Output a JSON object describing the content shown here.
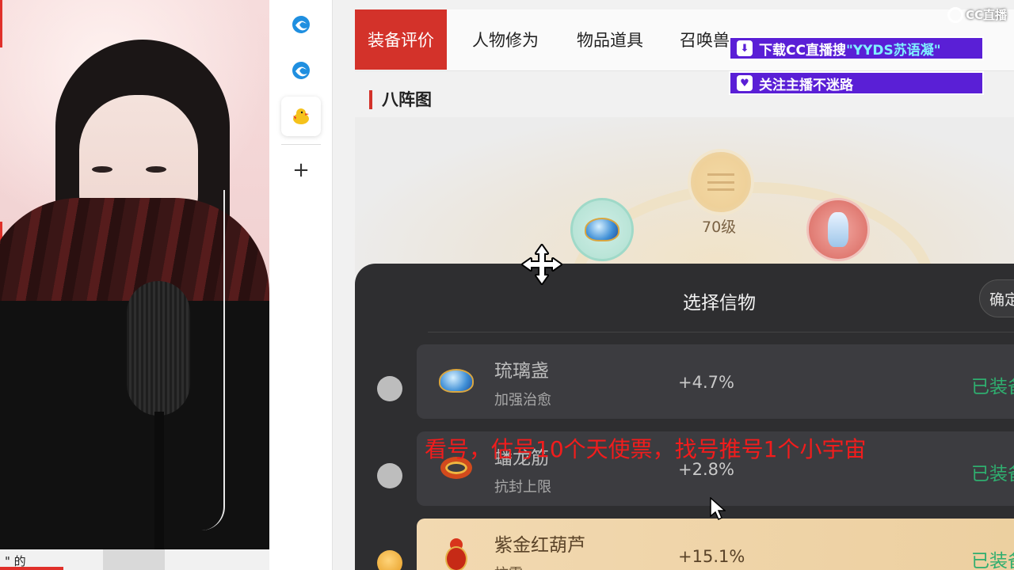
{
  "stream": {
    "cc_logo_text": "CC直播",
    "banner_download": {
      "prefix": "下载CC直播搜",
      "highlight": "\"YYDS苏语凝\""
    },
    "banner_follow": "关注主播不迷路",
    "scrolling_text": "看号，估号10个天使票，找号推号1个小宇宙",
    "camera_bottom_fragment": "\" 的"
  },
  "sidebar": {
    "items": [
      {
        "icon": "edge-browser-icon"
      },
      {
        "icon": "edge-browser-icon"
      },
      {
        "icon": "chick-app-icon",
        "active": true
      }
    ],
    "add_icon": "plus-icon",
    "add_glyph": "+"
  },
  "tabs": [
    {
      "label": "装备评价",
      "active": true
    },
    {
      "label": "人物修为"
    },
    {
      "label": "物品道具"
    },
    {
      "label": "召唤兽"
    }
  ],
  "section_title": "八阵图",
  "bagua": {
    "level": "70级"
  },
  "panel": {
    "title": "选择信物",
    "confirm_label": "确定",
    "items": [
      {
        "name": "琉璃盏",
        "desc": "加强治愈",
        "percent": "+4.7%",
        "status": "已装备",
        "selected": false,
        "icon": "glass-bowl-icon"
      },
      {
        "name": "蟠龙筋",
        "desc": "抗封上限",
        "percent": "+2.8%",
        "status": "已装备",
        "selected": false,
        "icon": "dragon-ring-icon"
      },
      {
        "name": "紫金红葫芦",
        "desc": "抗震",
        "percent": "+15.1%",
        "status": "已装备",
        "selected": true,
        "icon": "red-gourd-icon"
      }
    ]
  },
  "colors": {
    "accent_red": "#d3322a",
    "banner_purple": "#5a1fd6",
    "status_green": "#2fae6f",
    "scroll_text_red": "#f21c1c"
  }
}
